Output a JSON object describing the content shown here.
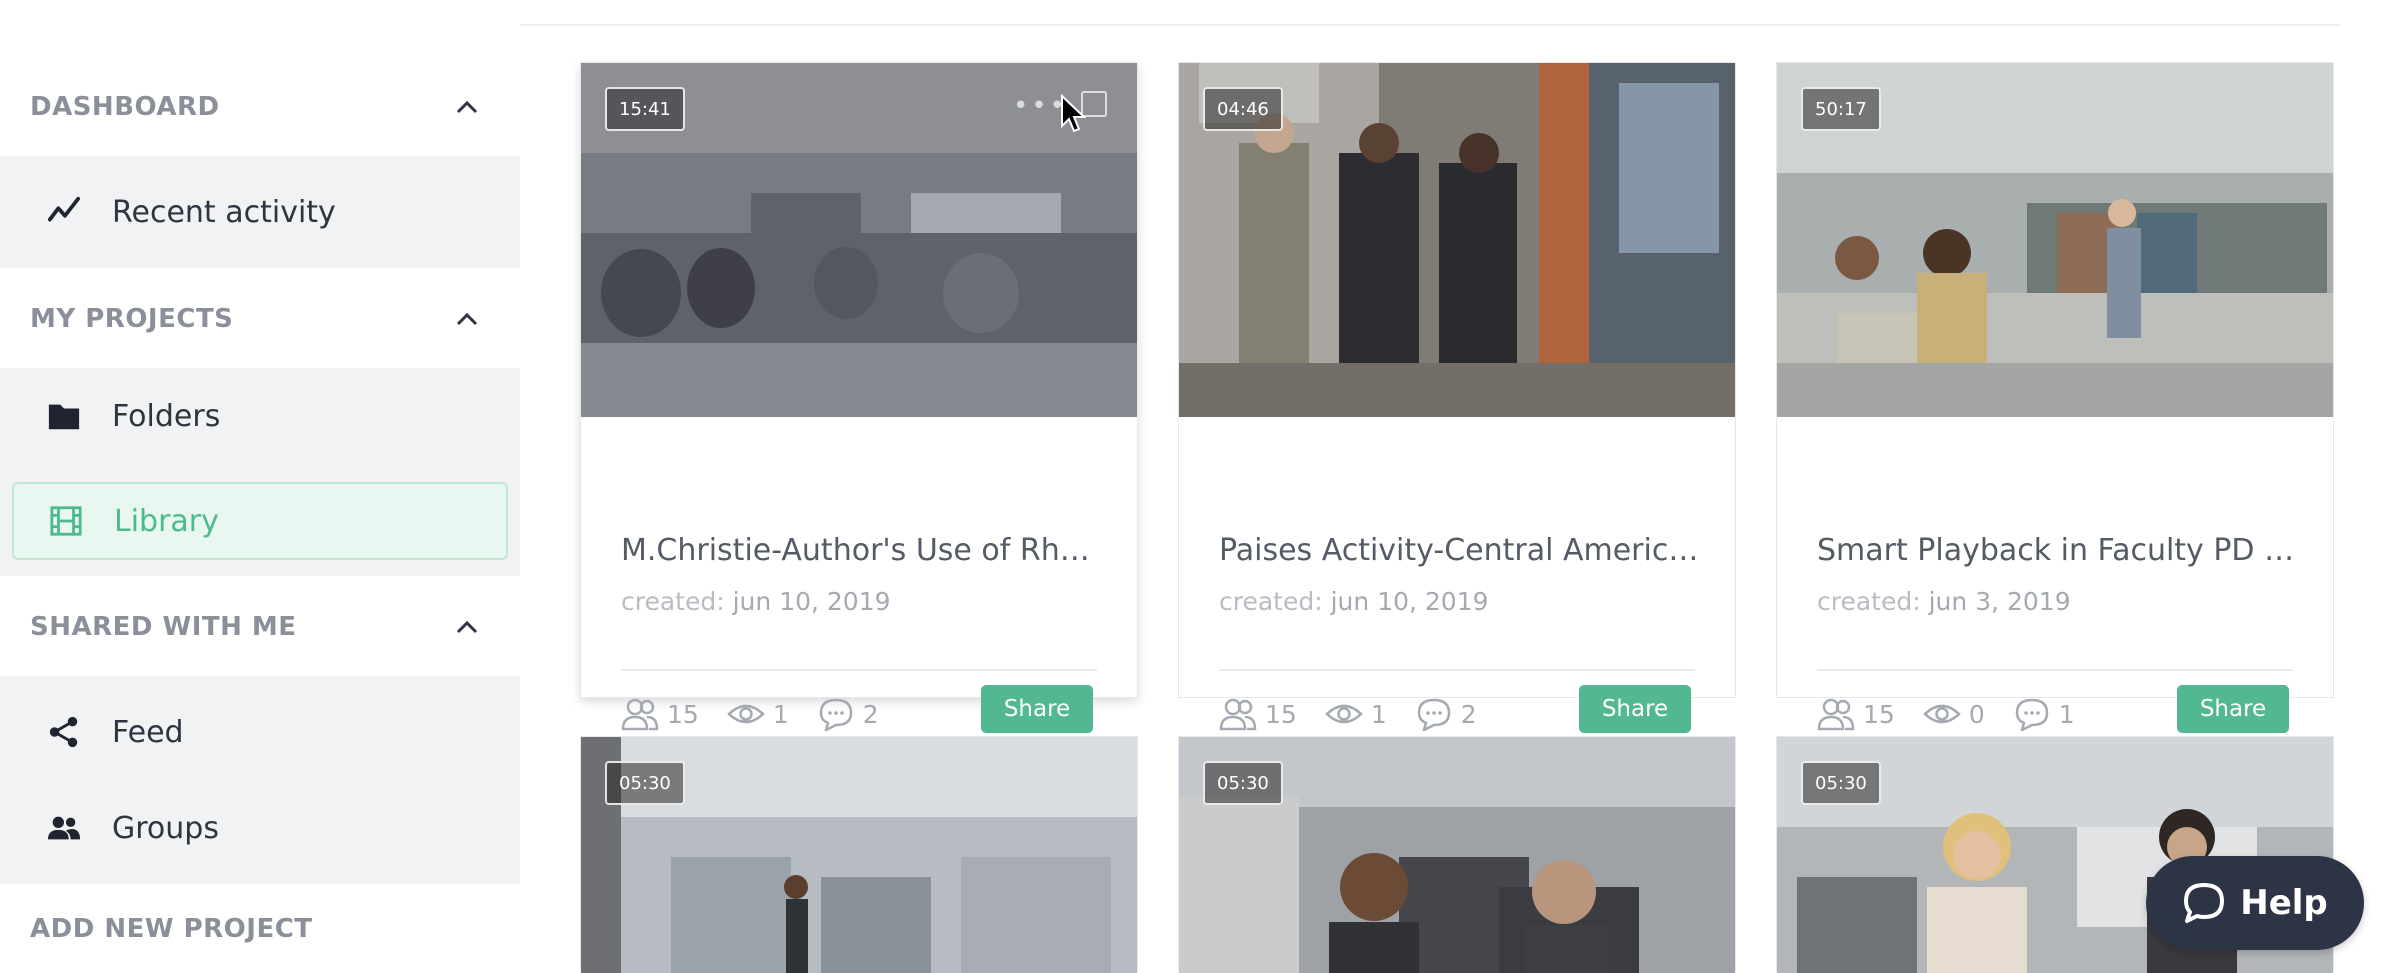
{
  "sidebar": {
    "dashboard_title": "DASHBOARD",
    "recent_activity": "Recent activity",
    "my_projects_title": "MY PROJECTS",
    "folders": "Folders",
    "library": "Library",
    "shared_title": "SHARED WITH ME",
    "feed": "Feed",
    "groups": "Groups",
    "add_new_project": "ADD NEW PROJECT"
  },
  "cards": [
    {
      "duration": "15:41",
      "title": "M.Christie-Author's Use of Rhetori...",
      "created_label": "created:",
      "created_date": "jun 10, 2019",
      "members": "15",
      "views": "1",
      "comments": "2",
      "share_label": "Share"
    },
    {
      "duration": "04:46",
      "title": "Paises Activity-Central America Te...",
      "created_label": "created:",
      "created_date": "jun 10, 2019",
      "members": "15",
      "views": "1",
      "comments": "2",
      "share_label": "Share"
    },
    {
      "duration": "50:17",
      "title": "Smart Playback in Faculty PD Sessi...",
      "created_label": "created:",
      "created_date": "jun 3, 2019",
      "members": "15",
      "views": "0",
      "comments": "1",
      "share_label": "Share"
    },
    {
      "duration": "05:30"
    },
    {
      "duration": "05:30"
    },
    {
      "duration": "05:30"
    }
  ],
  "help": {
    "label": "Help"
  },
  "colors": {
    "accent": "#52b891",
    "sidebar_group_bg": "#f1f2f4",
    "section_title": "#8a8f99",
    "help_bg": "#2d3446"
  },
  "icons": {
    "recent_activity": "trend-check-icon",
    "folders": "folder-icon",
    "library": "film-icon",
    "feed": "share-nodes-icon",
    "groups": "people-icon",
    "members": "users-icon",
    "views": "eye-icon",
    "comments": "comment-icon",
    "help": "chat-bubble-icon"
  }
}
